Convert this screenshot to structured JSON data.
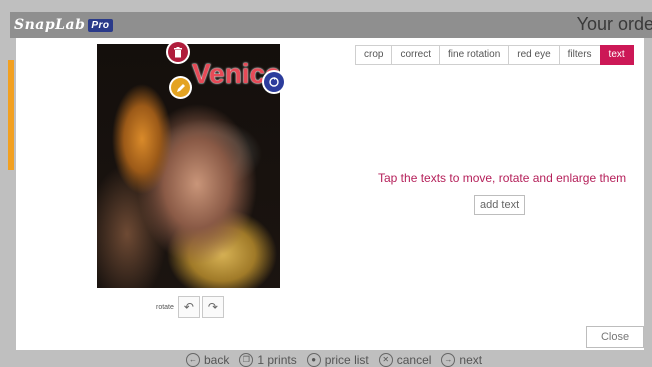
{
  "header": {
    "logo": "SnapLab",
    "logo_badge": "Pro",
    "title": "Your orde"
  },
  "photo": {
    "overlay_text": "Venice"
  },
  "rotate": {
    "label": "rotate"
  },
  "tabs": [
    {
      "label": "crop",
      "active": false
    },
    {
      "label": "correct",
      "active": false
    },
    {
      "label": "fine rotation",
      "active": false
    },
    {
      "label": "red eye",
      "active": false
    },
    {
      "label": "filters",
      "active": false
    },
    {
      "label": "text",
      "active": true
    }
  ],
  "instructions": "Tap the texts to move, rotate and enlarge them",
  "add_text_label": "add text",
  "close_label": "Close",
  "bottom_nav": {
    "back": "back",
    "prints": "1 prints",
    "price_list": "price list",
    "cancel": "cancel",
    "next": "next"
  },
  "colors": {
    "accent": "#cc1856",
    "header_bg": "#8f8f8f",
    "instruction": "#b5205a"
  }
}
